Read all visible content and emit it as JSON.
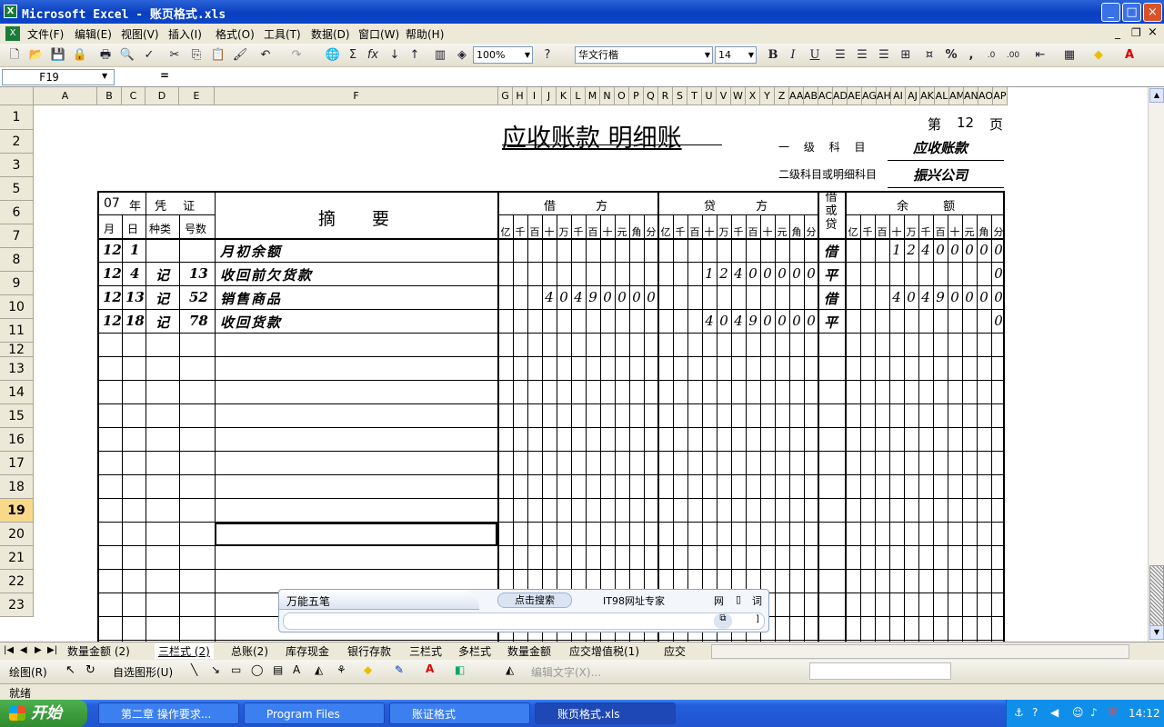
{
  "window": {
    "title": "Microsoft Excel - 账页格式.xls",
    "min": "_",
    "max": "□",
    "close": "×"
  },
  "menu": [
    "文件(F)",
    "编辑(E)",
    "视图(V)",
    "插入(I)",
    "格式(O)",
    "工具(T)",
    "数据(D)",
    "窗口(W)",
    "帮助(H)"
  ],
  "doc_buttons": {
    "min": "_",
    "restore": "❐",
    "close": "×"
  },
  "toolbar": {
    "zoom": "100%",
    "font": "华文行楷",
    "size": "14",
    "bold": "B",
    "italic": "I",
    "underline": "U",
    "percent": "%",
    "comma": ","
  },
  "formula": {
    "cell_ref": "F19",
    "eq": "="
  },
  "columns": [
    "A",
    "B",
    "C",
    "D",
    "E",
    "F",
    "G",
    "H",
    "I",
    "J",
    "K",
    "L",
    "M",
    "N",
    "O",
    "P",
    "Q",
    "R",
    "S",
    "T",
    "U",
    "V",
    "W",
    "X",
    "Y",
    "Z",
    "AA",
    "AB",
    "AC",
    "AD",
    "AE",
    "AF",
    "AG",
    "AH",
    "AI",
    "AJ",
    "AK",
    "AL",
    "AM",
    "AN",
    "AO",
    "AP"
  ],
  "rows": [
    "1",
    "2",
    "3",
    "5",
    "6",
    "7",
    "8",
    "9",
    "10",
    "11",
    "12",
    "13",
    "14",
    "15",
    "16",
    "17",
    "18",
    "19",
    "20",
    "21",
    "22",
    "23"
  ],
  "ledger": {
    "title": "应收账款 明细账",
    "page_label": "第",
    "page_num": "12",
    "page_unit": "页",
    "acct1_label": "一 级 科 目",
    "acct1_value": "应收账款",
    "acct2_label": "二级科目或明细科目",
    "acct2_value": "振兴公司",
    "year": "07",
    "year_label": "年",
    "voucher": "凭 证",
    "month": "月",
    "day": "日",
    "vtype": "种类",
    "vnum": "号数",
    "summary": "摘 要",
    "debit": "借 方",
    "credit": "贷 方",
    "dc": "借或贷",
    "balance": "余 额",
    "digits": [
      "亿",
      "千",
      "百",
      "十",
      "万",
      "千",
      "百",
      "十",
      "元",
      "角",
      "分"
    ],
    "entries": [
      {
        "m": "12",
        "d": "1",
        "t": "",
        "n": "",
        "text": "月初余额",
        "debit": "",
        "credit": "",
        "dc": "借",
        "bal": "12400000"
      },
      {
        "m": "12",
        "d": "4",
        "t": "记",
        "n": "13",
        "text": "收回前欠货款",
        "debit": "",
        "credit": "12400000",
        "dc": "平",
        "bal": "0"
      },
      {
        "m": "12",
        "d": "13",
        "t": "记",
        "n": "52",
        "text": "销售商品",
        "debit": "40490000",
        "credit": "",
        "dc": "借",
        "bal": "40490000"
      },
      {
        "m": "12",
        "d": "18",
        "t": "记",
        "n": "78",
        "text": "收回货款",
        "debit": "",
        "credit": "40490000",
        "dc": "平",
        "bal": "0"
      }
    ]
  },
  "ime": {
    "name": "万能五笔",
    "search": "点击搜索",
    "site": "IT98网址专家",
    "btn1": "网",
    "btn2": "▯",
    "btn3": "词"
  },
  "sheets": [
    "数量金额 (2)",
    "三栏式 (2)",
    "总账(2)",
    "库存现金",
    "银行存款",
    "三栏式",
    "多栏式",
    "数量金额",
    "应交增值税(1)",
    "应交"
  ],
  "drawbar": {
    "draw": "绘图(R)",
    "autoshape": "自选图形(U)",
    "wordart": "编辑文字(X)..."
  },
  "status": "就绪",
  "taskbar": {
    "start": "开始",
    "tasks": [
      "第二章 操作要求...",
      "Program Files",
      "账证格式",
      "账页格式.xls"
    ],
    "time": "14:12"
  }
}
